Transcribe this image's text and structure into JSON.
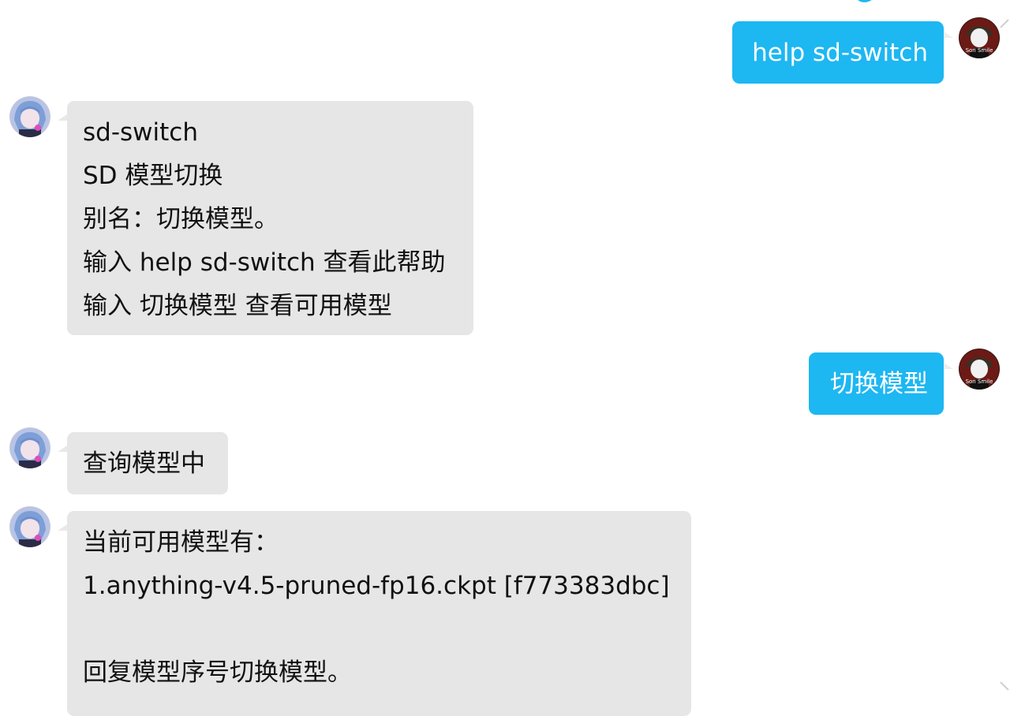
{
  "colors": {
    "user_bubble": "#1db7f2",
    "bot_bubble": "#e6e6e6",
    "background": "#ffffff"
  },
  "icons": {
    "bot_avatar": "anime-bot-avatar-icon",
    "user_avatar": "user-avatar-icon",
    "user_avatar_caption": "Son Smile"
  },
  "messages": [
    {
      "sender": "user",
      "lines": [
        "help sd-switch"
      ]
    },
    {
      "sender": "bot",
      "lines": [
        "sd-switch",
        "SD 模型切换",
        "别名：切换模型。",
        "输入 help sd-switch 查看此帮助",
        "输入 切换模型 查看可用模型"
      ]
    },
    {
      "sender": "user",
      "lines": [
        "切换模型"
      ]
    },
    {
      "sender": "bot",
      "lines": [
        "查询模型中"
      ]
    },
    {
      "sender": "bot",
      "lines": [
        "当前可用模型有：",
        "1.anything-v4.5-pruned-fp16.ckpt [f773383dbc]",
        "",
        "回复模型序号切换模型。"
      ]
    }
  ]
}
